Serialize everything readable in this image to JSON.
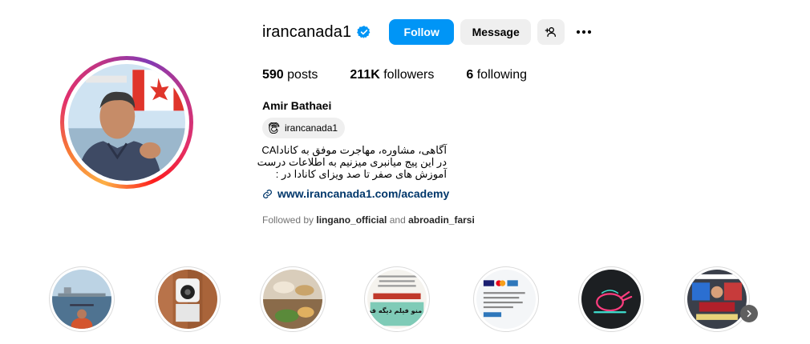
{
  "profile": {
    "username": "irancanada1",
    "verified": true,
    "full_name": "Amir Bathaei",
    "threads_handle": "irancanada1",
    "bio_lines": [
      "آگاهی، مشاوره، مهاجرت موفق به کاناداCA",
      "در این پیج میانبری میزنیم به اطلاعات درست",
      "آموزش های صفر تا صد ویزای کانادا در :"
    ],
    "link": "www.irancanada1.com/academy",
    "followed_by_prefix": "Followed by",
    "followed_by_user1": "lingano_official",
    "followed_by_and": "and",
    "followed_by_user2": "abroadin_farsi"
  },
  "actions": {
    "follow_label": "Follow",
    "message_label": "Message",
    "add_user_icon": "person-add-icon",
    "more_icon": "more-horizontal-icon"
  },
  "stats": {
    "posts_count": "590",
    "posts_label": "posts",
    "followers_count": "211K",
    "followers_label": "followers",
    "following_count": "6",
    "following_label": "following"
  },
  "highlights": {
    "items": [
      {
        "icon": "boat-harbor-thumbnail"
      },
      {
        "icon": "robot-vacuum-thumbnail"
      },
      {
        "icon": "food-table-thumbnail"
      },
      {
        "icon": "persian-text-post-thumbnail"
      },
      {
        "icon": "credit-cards-thumbnail"
      },
      {
        "icon": "neon-chicken-thumbnail"
      },
      {
        "icon": "store-sign-thumbnail"
      }
    ],
    "text_on_thumbnail_4": "غیر از منو فیلم دیگه قید همه"
  },
  "colors": {
    "accent": "#0095f6",
    "link": "#00376b",
    "button_gray": "#efefef",
    "muted_text": "#737373"
  }
}
